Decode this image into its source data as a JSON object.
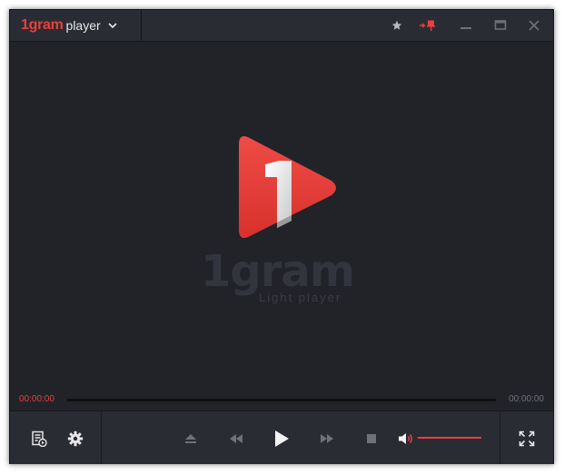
{
  "app": {
    "logo_text": "1gram",
    "name_text": "player"
  },
  "splash": {
    "wordmark": "1gram",
    "tagline": "Light player"
  },
  "playback": {
    "current_time": "00:00:00",
    "total_time": "00:00:00",
    "progress": 0,
    "volume": 1.0
  },
  "colors": {
    "accent": "#e8403b",
    "background": "#212329",
    "panel": "#2a2c33"
  },
  "icons": {
    "menu": "chevron-down-icon",
    "favorite": "star-icon",
    "pin": "pin-icon",
    "minimize": "minimize-icon",
    "maximize": "maximize-icon",
    "close": "close-icon",
    "playlist": "playlist-icon",
    "settings": "gear-icon",
    "eject": "eject-icon",
    "rewind": "rewind-icon",
    "play": "play-icon",
    "forward": "fast-forward-icon",
    "stop": "stop-icon",
    "volume": "volume-icon",
    "fullscreen": "fullscreen-icon"
  }
}
